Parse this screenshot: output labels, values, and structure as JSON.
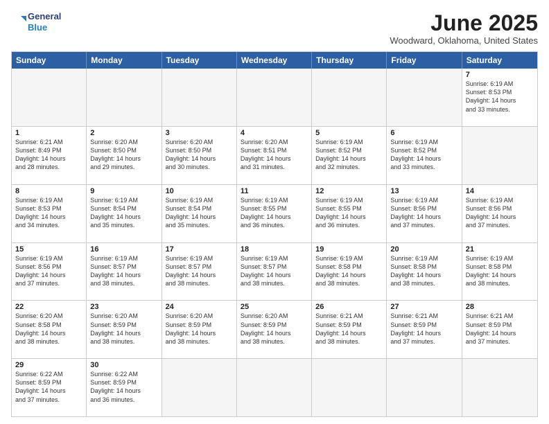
{
  "header": {
    "logo_general": "General",
    "logo_blue": "Blue",
    "month_title": "June 2025",
    "subtitle": "Woodward, Oklahoma, United States"
  },
  "calendar": {
    "days_of_week": [
      "Sunday",
      "Monday",
      "Tuesday",
      "Wednesday",
      "Thursday",
      "Friday",
      "Saturday"
    ],
    "weeks": [
      [
        {
          "day": "",
          "empty": true
        },
        {
          "day": "",
          "empty": true
        },
        {
          "day": "",
          "empty": true
        },
        {
          "day": "",
          "empty": true
        },
        {
          "day": "",
          "empty": true
        },
        {
          "day": "",
          "empty": true
        },
        {
          "day": "",
          "empty": true
        }
      ]
    ]
  },
  "cells": {
    "week1": [
      {
        "num": "",
        "empty": true,
        "lines": []
      },
      {
        "num": "",
        "empty": true,
        "lines": []
      },
      {
        "num": "",
        "empty": true,
        "lines": []
      },
      {
        "num": "",
        "empty": true,
        "lines": []
      },
      {
        "num": "",
        "empty": true,
        "lines": []
      },
      {
        "num": "",
        "empty": true,
        "lines": []
      },
      {
        "num": "",
        "empty": true,
        "lines": []
      }
    ],
    "week2": [
      {
        "num": "1",
        "empty": false,
        "lines": [
          "Sunrise: 6:21 AM",
          "Sunset: 8:49 PM",
          "Daylight: 14 hours",
          "and 28 minutes."
        ]
      },
      {
        "num": "2",
        "empty": false,
        "lines": [
          "Sunrise: 6:20 AM",
          "Sunset: 8:50 PM",
          "Daylight: 14 hours",
          "and 29 minutes."
        ]
      },
      {
        "num": "3",
        "empty": false,
        "lines": [
          "Sunrise: 6:20 AM",
          "Sunset: 8:50 PM",
          "Daylight: 14 hours",
          "and 30 minutes."
        ]
      },
      {
        "num": "4",
        "empty": false,
        "lines": [
          "Sunrise: 6:20 AM",
          "Sunset: 8:51 PM",
          "Daylight: 14 hours",
          "and 31 minutes."
        ]
      },
      {
        "num": "5",
        "empty": false,
        "lines": [
          "Sunrise: 6:19 AM",
          "Sunset: 8:52 PM",
          "Daylight: 14 hours",
          "and 32 minutes."
        ]
      },
      {
        "num": "6",
        "empty": false,
        "lines": [
          "Sunrise: 6:19 AM",
          "Sunset: 8:52 PM",
          "Daylight: 14 hours",
          "and 33 minutes."
        ]
      },
      {
        "num": "7",
        "empty": false,
        "lines": [
          "Sunrise: 6:19 AM",
          "Sunset: 8:53 PM",
          "Daylight: 14 hours",
          "and 33 minutes."
        ]
      }
    ],
    "week3": [
      {
        "num": "8",
        "empty": false,
        "lines": [
          "Sunrise: 6:19 AM",
          "Sunset: 8:53 PM",
          "Daylight: 14 hours",
          "and 34 minutes."
        ]
      },
      {
        "num": "9",
        "empty": false,
        "lines": [
          "Sunrise: 6:19 AM",
          "Sunset: 8:54 PM",
          "Daylight: 14 hours",
          "and 35 minutes."
        ]
      },
      {
        "num": "10",
        "empty": false,
        "lines": [
          "Sunrise: 6:19 AM",
          "Sunset: 8:54 PM",
          "Daylight: 14 hours",
          "and 35 minutes."
        ]
      },
      {
        "num": "11",
        "empty": false,
        "lines": [
          "Sunrise: 6:19 AM",
          "Sunset: 8:55 PM",
          "Daylight: 14 hours",
          "and 36 minutes."
        ]
      },
      {
        "num": "12",
        "empty": false,
        "lines": [
          "Sunrise: 6:19 AM",
          "Sunset: 8:55 PM",
          "Daylight: 14 hours",
          "and 36 minutes."
        ]
      },
      {
        "num": "13",
        "empty": false,
        "lines": [
          "Sunrise: 6:19 AM",
          "Sunset: 8:56 PM",
          "Daylight: 14 hours",
          "and 37 minutes."
        ]
      },
      {
        "num": "14",
        "empty": false,
        "lines": [
          "Sunrise: 6:19 AM",
          "Sunset: 8:56 PM",
          "Daylight: 14 hours",
          "and 37 minutes."
        ]
      }
    ],
    "week4": [
      {
        "num": "15",
        "empty": false,
        "lines": [
          "Sunrise: 6:19 AM",
          "Sunset: 8:56 PM",
          "Daylight: 14 hours",
          "and 37 minutes."
        ]
      },
      {
        "num": "16",
        "empty": false,
        "lines": [
          "Sunrise: 6:19 AM",
          "Sunset: 8:57 PM",
          "Daylight: 14 hours",
          "and 38 minutes."
        ]
      },
      {
        "num": "17",
        "empty": false,
        "lines": [
          "Sunrise: 6:19 AM",
          "Sunset: 8:57 PM",
          "Daylight: 14 hours",
          "and 38 minutes."
        ]
      },
      {
        "num": "18",
        "empty": false,
        "lines": [
          "Sunrise: 6:19 AM",
          "Sunset: 8:57 PM",
          "Daylight: 14 hours",
          "and 38 minutes."
        ]
      },
      {
        "num": "19",
        "empty": false,
        "lines": [
          "Sunrise: 6:19 AM",
          "Sunset: 8:58 PM",
          "Daylight: 14 hours",
          "and 38 minutes."
        ]
      },
      {
        "num": "20",
        "empty": false,
        "lines": [
          "Sunrise: 6:19 AM",
          "Sunset: 8:58 PM",
          "Daylight: 14 hours",
          "and 38 minutes."
        ]
      },
      {
        "num": "21",
        "empty": false,
        "lines": [
          "Sunrise: 6:19 AM",
          "Sunset: 8:58 PM",
          "Daylight: 14 hours",
          "and 38 minutes."
        ]
      }
    ],
    "week5": [
      {
        "num": "22",
        "empty": false,
        "lines": [
          "Sunrise: 6:20 AM",
          "Sunset: 8:58 PM",
          "Daylight: 14 hours",
          "and 38 minutes."
        ]
      },
      {
        "num": "23",
        "empty": false,
        "lines": [
          "Sunrise: 6:20 AM",
          "Sunset: 8:59 PM",
          "Daylight: 14 hours",
          "and 38 minutes."
        ]
      },
      {
        "num": "24",
        "empty": false,
        "lines": [
          "Sunrise: 6:20 AM",
          "Sunset: 8:59 PM",
          "Daylight: 14 hours",
          "and 38 minutes."
        ]
      },
      {
        "num": "25",
        "empty": false,
        "lines": [
          "Sunrise: 6:20 AM",
          "Sunset: 8:59 PM",
          "Daylight: 14 hours",
          "and 38 minutes."
        ]
      },
      {
        "num": "26",
        "empty": false,
        "lines": [
          "Sunrise: 6:21 AM",
          "Sunset: 8:59 PM",
          "Daylight: 14 hours",
          "and 38 minutes."
        ]
      },
      {
        "num": "27",
        "empty": false,
        "lines": [
          "Sunrise: 6:21 AM",
          "Sunset: 8:59 PM",
          "Daylight: 14 hours",
          "and 37 minutes."
        ]
      },
      {
        "num": "28",
        "empty": false,
        "lines": [
          "Sunrise: 6:21 AM",
          "Sunset: 8:59 PM",
          "Daylight: 14 hours",
          "and 37 minutes."
        ]
      }
    ],
    "week6": [
      {
        "num": "29",
        "empty": false,
        "lines": [
          "Sunrise: 6:22 AM",
          "Sunset: 8:59 PM",
          "Daylight: 14 hours",
          "and 37 minutes."
        ]
      },
      {
        "num": "30",
        "empty": false,
        "lines": [
          "Sunrise: 6:22 AM",
          "Sunset: 8:59 PM",
          "Daylight: 14 hours",
          "and 36 minutes."
        ]
      },
      {
        "num": "",
        "empty": true,
        "lines": []
      },
      {
        "num": "",
        "empty": true,
        "lines": []
      },
      {
        "num": "",
        "empty": true,
        "lines": []
      },
      {
        "num": "",
        "empty": true,
        "lines": []
      },
      {
        "num": "",
        "empty": true,
        "lines": []
      }
    ]
  }
}
